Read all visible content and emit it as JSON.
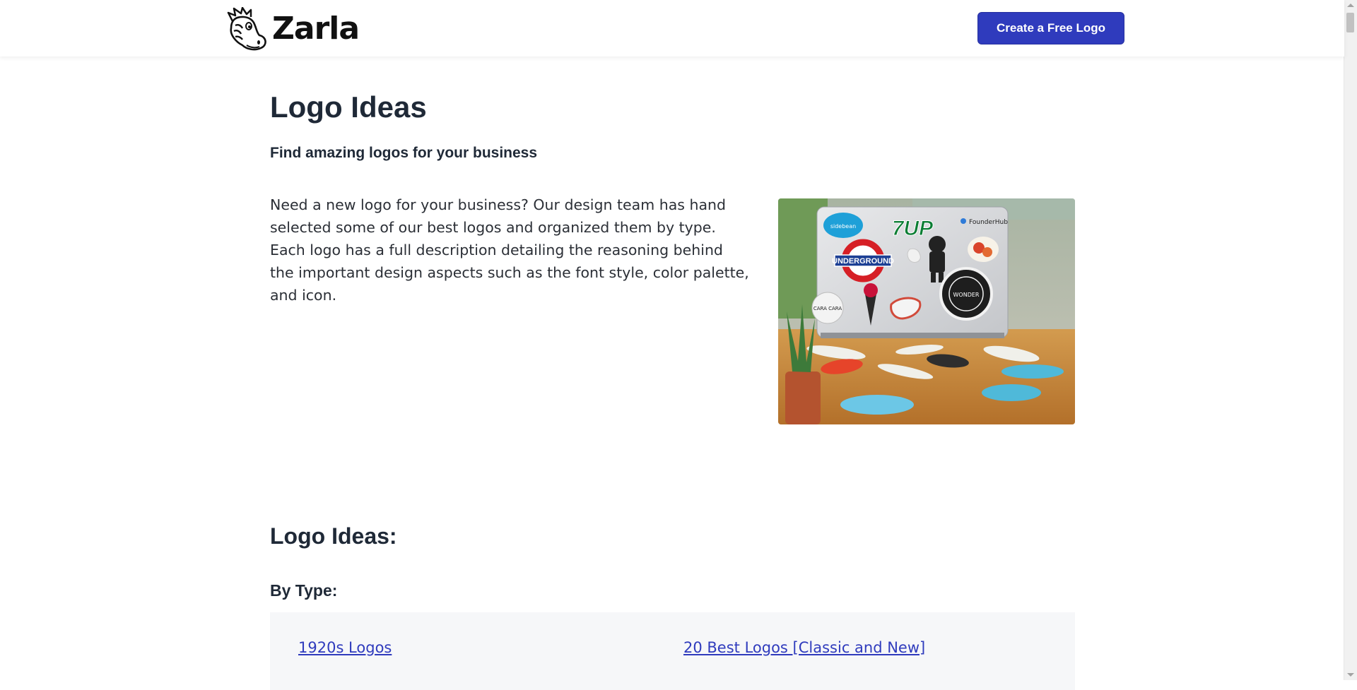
{
  "header": {
    "brand_name": "Zarla",
    "cta_label": "Create a Free Logo"
  },
  "main": {
    "title": "Logo Ideas",
    "subtitle": "Find amazing logos for your business",
    "intro": "Need a new logo for your business? Our design team has hand selected some of our best logos and organized them by type. Each logo has a full description detailing the reasoning behind the important design aspects such as the font style, color palette, and icon."
  },
  "hero_stickers": {
    "sidebean": "sidebean",
    "seven_up": "7UP",
    "founderhub": "FounderHub",
    "underground": "UNDERGROUND",
    "cara": "CARA CARA",
    "wonder": "WONDER"
  },
  "ideas": {
    "heading": "Logo Ideas:",
    "by_type_heading": "By Type:",
    "links": [
      "1920s Logos",
      "20 Best Logos [Classic and New]"
    ]
  },
  "colors": {
    "accent": "#2f3bbd",
    "text": "#1f2937",
    "panel_bg": "#f6f7f9"
  },
  "icons": {
    "brand": "zebra-head-icon"
  }
}
